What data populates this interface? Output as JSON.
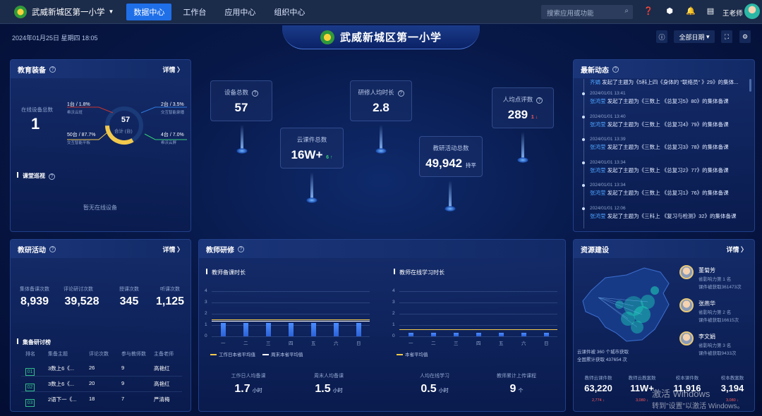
{
  "topbar": {
    "school_name": "武威新城区第一小学",
    "nav": [
      "数据中心",
      "工作台",
      "应用中心",
      "组织中心"
    ],
    "active_nav": 0,
    "search_placeholder": "搜索应用或功能",
    "username": "王老师"
  },
  "header": {
    "datetime": "2024年01月25日 星期四 18:05",
    "title": "武威新城区第一小学",
    "date_filter": "全部日期"
  },
  "edu_equipment": {
    "title": "教育装备",
    "more": "详情 〉",
    "online_label": "在线设备总数",
    "online_value": "1",
    "donut_total": "57",
    "donut_sub": "合计 (台)",
    "segments": [
      {
        "label": "1台 / 1.8%",
        "sub": "希沃云班"
      },
      {
        "label": "2台 / 3.5%",
        "sub": "交互智能录播"
      },
      {
        "label": "50台 / 87.7%",
        "sub": "交互智能平板"
      },
      {
        "label": "4台 / 7.0%",
        "sub": "希沃云屏"
      }
    ],
    "patrol_title": "课堂巡视",
    "patrol_empty": "暂无在线设备"
  },
  "center_stats": [
    {
      "label": "设备总数",
      "value": "57",
      "has_q": true
    },
    {
      "label": "云课件总数",
      "value": "16W+",
      "trend": "6 ↑",
      "trend_color": "#36d07a"
    },
    {
      "label": "研修人均时长",
      "value": "2.8",
      "has_q": true
    },
    {
      "label": "教研活动总数",
      "value": "49,942",
      "unit": "持平"
    },
    {
      "label": "人均点评数",
      "value": "289",
      "trend": "1 ↓",
      "trend_color": "#ff5a5a",
      "has_q": true
    }
  ],
  "news": {
    "title": "最新动态",
    "top_line": {
      "who": "齐娟",
      "text": " 发起了主题为《5科上四《身体的 \"联络员\" 》29》的集体..."
    },
    "items": [
      {
        "time": "2024/01/01 13:41",
        "who": "张鸿莹",
        "text": " 发起了主题为《三数上 《总复习5》80》的集体备课"
      },
      {
        "time": "2024/01/01 13:40",
        "who": "张鸿莹",
        "text": " 发起了主题为《三数上 《总复习4》79》的集体备课"
      },
      {
        "time": "2024/01/01 13:39",
        "who": "张鸿莹",
        "text": " 发起了主题为《三数上 《总复习3》78》的集体备课"
      },
      {
        "time": "2024/01/01 13:34",
        "who": "张鸿莹",
        "text": " 发起了主题为《三数上 《总复习2》77》的集体备课"
      },
      {
        "time": "2024/01/01 13:34",
        "who": "张鸿莹",
        "text": " 发起了主题为《三数上 《总复习1》76》的集体备课"
      },
      {
        "time": "2024/01/01 12:06",
        "who": "张鸿莹",
        "text": " 发起了主题为《三科上 《复习与检测》32》的集体备课"
      }
    ]
  },
  "research": {
    "title": "教研活动",
    "more": "详情 〉",
    "stats": [
      {
        "label": "集体备课次数",
        "value": "8,939"
      },
      {
        "label": "评论研讨次数",
        "value": "39,528"
      },
      {
        "label": "授课次数",
        "value": "345"
      },
      {
        "label": "听课次数",
        "value": "1,125"
      }
    ],
    "ranking_title": "集备研讨榜",
    "columns": [
      "排名",
      "集备主题",
      "评论次数",
      "参与教师数",
      "主备老师"
    ],
    "rows": [
      {
        "rank": "01",
        "topic": "3数上6《...",
        "comments": "26",
        "teachers": "9",
        "lead": "高艳红"
      },
      {
        "rank": "02",
        "topic": "3数上6《...",
        "comments": "20",
        "teachers": "9",
        "lead": "高艳红"
      },
      {
        "rank": "03",
        "topic": "2语下一《...",
        "comments": "18",
        "teachers": "7",
        "lead": "严清梅"
      }
    ]
  },
  "training": {
    "title": "教师研修",
    "left_chart_title": "教师备课时长",
    "right_chart_title": "教师在线学习时长",
    "left_legend": [
      "工作日本省平均值",
      "周末本省平均值"
    ],
    "right_legend": [
      "本省平均值"
    ],
    "days": [
      "一",
      "二",
      "三",
      "四",
      "五",
      "六",
      "日"
    ],
    "yticks": [
      "0",
      "1",
      "2",
      "3",
      "4"
    ],
    "metrics": [
      {
        "label": "工作日人均备课",
        "value": "1.7",
        "unit": "小时"
      },
      {
        "label": "周末人均备课",
        "value": "1.5",
        "unit": "小时"
      },
      {
        "label": "人均在线学习",
        "value": "0.5",
        "unit": "小时"
      },
      {
        "label": "教师累计上传课程",
        "value": "9",
        "unit": "个"
      }
    ]
  },
  "chart_data": [
    {
      "type": "bar",
      "title": "教师备课时长",
      "categories": [
        "一",
        "二",
        "三",
        "四",
        "五",
        "六",
        "日"
      ],
      "values": [
        1.2,
        1.2,
        1.2,
        1.2,
        1.2,
        1.2,
        1.2
      ],
      "ylim": [
        0,
        4
      ],
      "reference_lines": [
        {
          "name": "工作日本省平均值",
          "value": 1.5
        },
        {
          "name": "周末本省平均值",
          "value": 1.4
        }
      ]
    },
    {
      "type": "bar",
      "title": "教师在线学习时长",
      "categories": [
        "一",
        "二",
        "三",
        "四",
        "五",
        "六",
        "日"
      ],
      "values": [
        0.3,
        0.3,
        0.3,
        0.3,
        0.3,
        0.3,
        0.3
      ],
      "ylim": [
        0,
        4
      ],
      "reference_lines": [
        {
          "name": "本省平均值",
          "value": 0.6
        }
      ]
    }
  ],
  "resources": {
    "title": "资源建设",
    "more": "详情 〉",
    "map_caption_1": "云课件被 360 个城市获取",
    "map_caption_2": "全国累计获取 437654 次",
    "people": [
      {
        "name": "董菊芳",
        "rank": "省影响力第 1 名",
        "count": "课件被获取361473次"
      },
      {
        "name": "张燕华",
        "rank": "省影响力第 2 名",
        "count": "课件被获取16615次"
      },
      {
        "name": "李文娟",
        "rank": "省影响力第 3 名",
        "count": "课件被获取9433次"
      }
    ],
    "stats": [
      {
        "label": "教师云课件数",
        "value": "63,220",
        "delta": "2,774 ↓"
      },
      {
        "label": "教师云教案数",
        "value": "11W+",
        "delta": "3,080 ↓"
      },
      {
        "label": "校本课件数",
        "value": "11,916",
        "delta": ""
      },
      {
        "label": "校本教案数",
        "value": "3,194",
        "delta": "3,080 ↓"
      }
    ]
  },
  "watermark": {
    "line1": "激活 Windows",
    "line2": "转到\"设置\"以激活 Windows。"
  }
}
